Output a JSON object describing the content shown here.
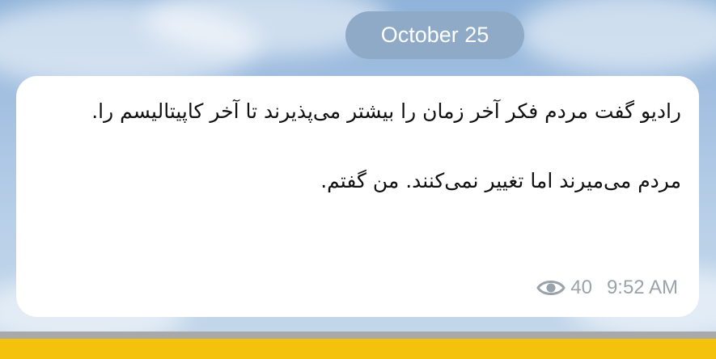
{
  "date_pill": "October 25",
  "message": {
    "paragraph_1": "رادیو گفت مردم  فکر آخر زمان را بیشتر می‌پذیرند تا آخر کاپیتالیسم را.",
    "paragraph_2": "مردم می‌میرند اما تغییر نمی‌کنند. من گفتم.",
    "views": "40",
    "time": "9:52 AM"
  },
  "icons": {
    "views": "eye-icon"
  },
  "colors": {
    "sky": "#a6c2e2",
    "date_pill_bg": "#8faac6",
    "bubble_bg": "#ffffff",
    "meta_text": "#9aa3aa",
    "bottom_bar": "#f4c20d"
  }
}
